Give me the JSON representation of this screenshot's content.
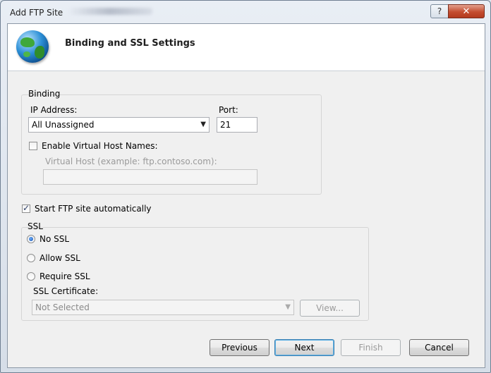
{
  "window": {
    "title": "Add FTP Site",
    "help_glyph": "?",
    "close_glyph": "✕"
  },
  "header": {
    "title": "Binding and SSL Settings"
  },
  "binding": {
    "group_label": "Binding",
    "ip_label": "IP Address:",
    "ip_value": "All Unassigned",
    "port_label": "Port:",
    "port_value": "21",
    "virtual_host_checkbox_label": "Enable Virtual Host Names:",
    "virtual_host_checked": false,
    "virtual_host_label": "Virtual Host (example: ftp.contoso.com):",
    "virtual_host_value": ""
  },
  "start_auto": {
    "label": "Start FTP site automatically",
    "checked": true
  },
  "ssl": {
    "group_label": "SSL",
    "options": [
      "No SSL",
      "Allow SSL",
      "Require SSL"
    ],
    "selected": "No SSL",
    "cert_label": "SSL Certificate:",
    "cert_value": "Not Selected",
    "view_button": "View..."
  },
  "footer": {
    "previous": "Previous",
    "next": "Next",
    "finish": "Finish",
    "cancel": "Cancel"
  },
  "icons": {
    "globe": "globe-icon",
    "dropdown": "chevron-down-icon",
    "check": "checkmark-icon"
  }
}
